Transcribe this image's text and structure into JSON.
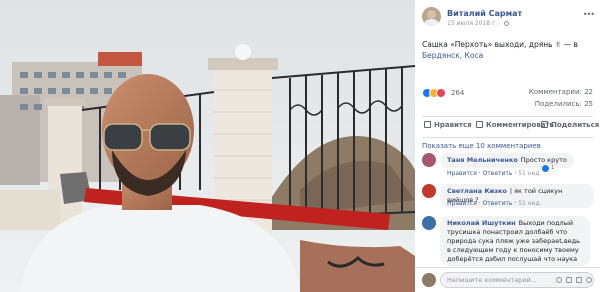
{
  "post": {
    "author": "Виталий Сармат",
    "date": "15 июля 2018 г.",
    "text": "Сашка «Перхоть» выходи, дрянь",
    "emoji": "✌",
    "location_prefix": "— в",
    "location_link": "Бердянск, Коса",
    "reaction_count": "264",
    "comments_count": "Комментарии: 22",
    "shares_count": "Поделились: 25"
  },
  "actions": {
    "like": "Нравится",
    "comment": "Комментировать",
    "share": "Поделиться"
  },
  "show_more": "Показать еще 10 комментариев",
  "comments": [
    {
      "name": "Таня Мельниченко",
      "text": "Просто круто",
      "like": "Нравится",
      "reply": "Ответить",
      "time": "51 нед.",
      "reactions": "1"
    },
    {
      "name": "Светлана Кизко",
      "text": "| як той сцикун вийшов ?",
      "like": "Нравится",
      "reply": "Ответить",
      "time": "51 нед.",
      "reactions": ""
    },
    {
      "name": "Николай Ишуткин",
      "text": "Выходи подлый трусишка понастроил долбаёб что природа сука пляж уже забераеt,ведь в следующем году к поносиму твоему доберётся дэбил послушай что наука говорит урод",
      "like": "",
      "reply": "",
      "time": "",
      "reactions": ""
    }
  ],
  "composer": {
    "placeholder": "Напишите комментарий..."
  },
  "colors": {
    "link": "#385898",
    "like": "#1877f2",
    "haha": "#f7b125",
    "love": "#e9425b"
  }
}
